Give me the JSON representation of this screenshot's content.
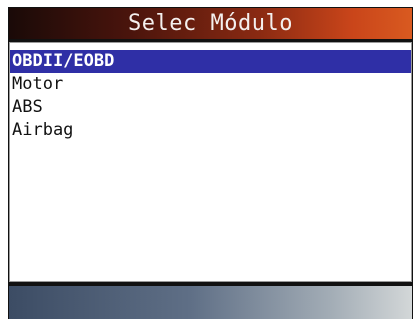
{
  "title": "Selec Módulo",
  "menu": {
    "items": [
      {
        "label": "OBDII/EOBD",
        "selected": true
      },
      {
        "label": "Motor",
        "selected": false
      },
      {
        "label": "ABS",
        "selected": false
      },
      {
        "label": "Airbag",
        "selected": false
      }
    ]
  },
  "colors": {
    "selection": "#2f2fa6",
    "title_gradient_end": "#d95a20",
    "bottom_bar_start": "#3c4c64"
  }
}
